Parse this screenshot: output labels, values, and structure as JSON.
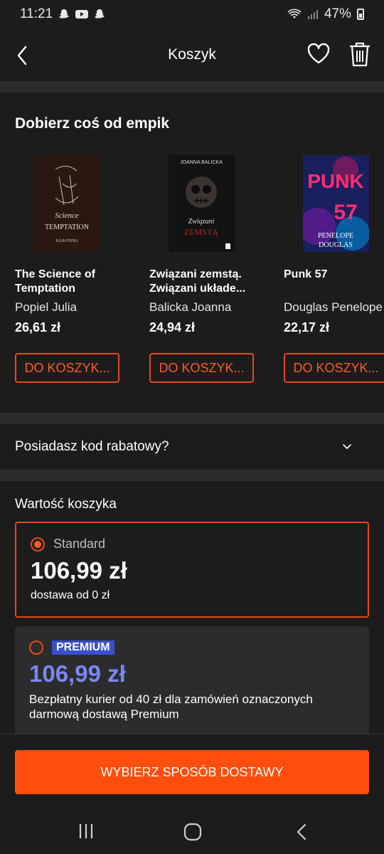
{
  "status_bar": {
    "time": "11:21",
    "battery": "47%",
    "left_icons": [
      "snapchat-icon",
      "youtube-icon",
      "snapchat-icon"
    ],
    "right_icons": [
      "wifi-icon",
      "signal-icon",
      "battery-icon"
    ]
  },
  "header": {
    "title": "Koszyk",
    "icons": [
      "back-arrow-icon",
      "heart-icon",
      "trash-icon"
    ]
  },
  "recommendations": {
    "title": "Dobierz coś od empik",
    "products": [
      {
        "title": "The Science of\nTemptation",
        "author": "Popiel Julia",
        "price": "26,61 zł",
        "button": "DO KOSZYK...",
        "cover_text": "THE Science of TEMPTATION",
        "cover_author": "JULIA POPIEL"
      },
      {
        "title": "Związani zemstą.\nZwiązani układe...",
        "author": "Balicka Joanna",
        "price": "24,94 zł",
        "button": "DO KOSZYK...",
        "cover_text": "Związani ZEMSTĄ",
        "cover_author": "JOANNA BALICKA"
      },
      {
        "title": "Punk 57",
        "author": "Douglas Penelope",
        "price": "22,17 zł",
        "button": "DO KOSZYK...",
        "cover_text": "PUNK 57",
        "cover_author": "PENELOPE DOUGLAS"
      }
    ]
  },
  "promo": {
    "label": "Posiadasz kod rabatowy?"
  },
  "cart_value": {
    "title": "Wartość koszyka",
    "standard": {
      "label": "Standard",
      "price": "106,99 zł",
      "note": "dostawa od 0 zł",
      "selected": true
    },
    "premium": {
      "badge": "PREMIUM",
      "price": "106,99 zł",
      "note": "Bezpłatny kurier od 40 zł dla zamówień oznaczonych darmową dostawą Premium",
      "selected": false
    }
  },
  "footer": {
    "cta": "WYBIERZ SPOSÓB DOSTAWY"
  },
  "colors": {
    "background": "#1c1c1c",
    "band": "#2c2c2c",
    "accent": "#ff4e0d",
    "premium_badge": "#3b4fd1",
    "premium_price": "#7c86f2"
  }
}
